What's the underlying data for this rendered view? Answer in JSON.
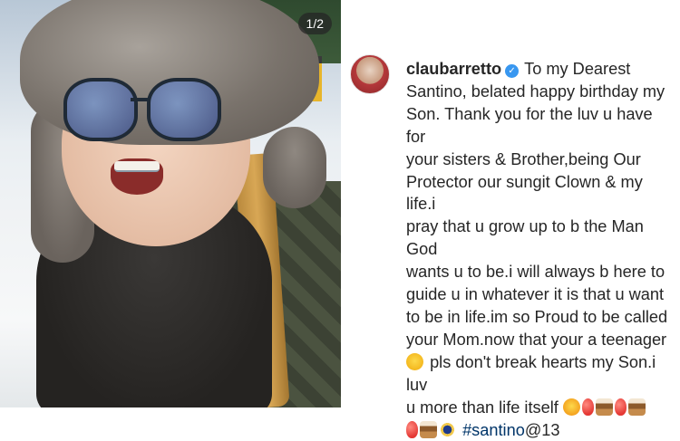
{
  "post": {
    "image_counter": "1/2",
    "username": "claubarretto",
    "verified": true,
    "caption_lines": [
      "To my Dearest",
      "Santino, belated happy birthday my",
      "Son. Thank you for the luv u have for",
      "your sisters & Brother,being Our",
      "Protector our sungit Clown & my life.i",
      "pray that u grow up to b the Man God",
      "wants u to be.i will always b here to",
      "guide u in whatever it is that u want",
      "to be in life.im so Proud to be called",
      "your Mom.now that your a teenager"
    ],
    "caption_line_11": "pls don't break hearts my Son.i luv",
    "caption_line_12": "u more than life itself",
    "hashtag": "#santino",
    "mention_suffix": "@13",
    "emojis": {
      "line_11": [
        "face-screaming-icon"
      ],
      "line_12": [
        "smiling-face-with-hearts-icon",
        "balloon-icon",
        "cake-icon",
        "balloon-icon",
        "cake-icon"
      ],
      "line_13": [
        "balloon-icon",
        "cake-icon",
        "fleur-de-lis-icon"
      ]
    },
    "colors": {
      "text": "#262626",
      "verified_badge": "#3897f0",
      "hashtag": "#003569"
    }
  }
}
